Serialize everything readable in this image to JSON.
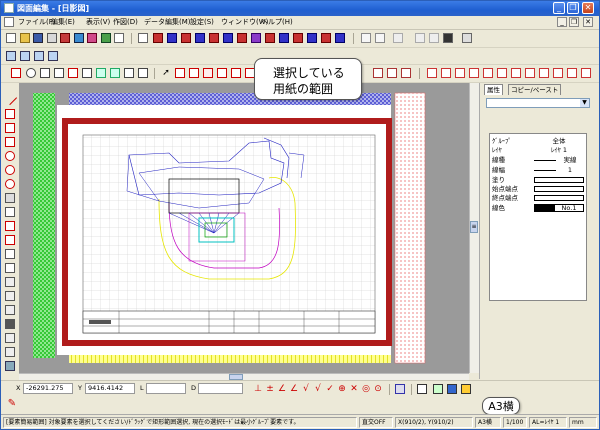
{
  "window": {
    "title": "図面編集 - [日影図]",
    "minimize": "_",
    "restore": "❐",
    "close": "✕"
  },
  "menu": {
    "items": [
      "ファイル(F)",
      "編集(E)",
      "表示(V)",
      "作図(D)",
      "データ編集(M)",
      "設定(S)",
      "ウィンドウ(W)",
      "ヘルプ(H)"
    ],
    "mdi_controls": [
      "_",
      "❐",
      "✕"
    ]
  },
  "properties_panel": {
    "tabs": [
      "属性",
      "コピー/ペースト"
    ],
    "rows": [
      {
        "key": "ｸﾞﾙｰﾌﾟ",
        "value": "全体"
      },
      {
        "key": "ﾚｲﾔ",
        "value": "ﾚｲﾔ 1"
      },
      {
        "key": "線種",
        "value": "実線"
      },
      {
        "key": "線幅",
        "value": "1"
      },
      {
        "key": "塗り",
        "value": ""
      },
      {
        "key": "始点端点",
        "value": ""
      },
      {
        "key": "終点端点",
        "value": ""
      },
      {
        "key": "線色",
        "value": "No.1"
      }
    ]
  },
  "coords": {
    "x_label": "X",
    "x_value": "-26291.275",
    "y_label": "Y",
    "y_value": "9416.4142",
    "l_label": "L",
    "d_label": "D"
  },
  "status": {
    "message": "[要素簡易範囲] 対象要素を選択してください/ﾄﾞﾗｯｸﾞで矩形範囲選択, 現在の選択ﾓｰﾄﾞは最小ｸﾞﾙｰﾌﾟ要素です。",
    "grid": "直交OFF",
    "xy": "X(910/2), Y(910/2)",
    "paper": "A3横",
    "scale": "1/100",
    "layer": "AL=ﾚｲﾔ 1",
    "unit": "mm"
  },
  "annotations": {
    "paper_range": "選択している\n用紙の範囲",
    "paper_size": "A3横"
  },
  "colors": {
    "titlebar": "#1f5fd1",
    "paper_border": "#b01c1c",
    "green_margin": "#2fd12f",
    "blue_margin": "#3a3acc",
    "yellow_margin": "#e8e800"
  }
}
